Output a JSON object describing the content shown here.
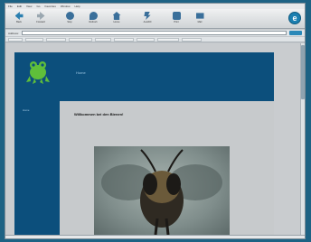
{
  "menubar": {
    "items": [
      "File",
      "Edit",
      "View",
      "Go",
      "Favorites",
      "Window",
      "Help"
    ]
  },
  "toolbar": {
    "buttons": [
      {
        "label": "Back",
        "icon": "back-arrow-icon",
        "color": "#2a7fb0"
      },
      {
        "label": "Forward",
        "icon": "forward-arrow-icon",
        "color": "#9aa7b0"
      },
      {
        "label": "Stop",
        "icon": "stop-icon",
        "color": "#3a6f9a"
      },
      {
        "label": "Refresh",
        "icon": "refresh-icon",
        "color": "#3a6f9a"
      },
      {
        "label": "Home",
        "icon": "home-icon",
        "color": "#3a6f9a"
      },
      {
        "label": "AutoFill",
        "icon": "autofill-icon",
        "color": "#3a6f9a"
      },
      {
        "label": "Print",
        "icon": "print-icon",
        "color": "#3a6f9a"
      },
      {
        "label": "Mail",
        "icon": "mail-icon",
        "color": "#3a6f9a"
      }
    ],
    "brand_icon": "e"
  },
  "address": {
    "label": "Address:",
    "value": ""
  },
  "favorites": {
    "items": [
      "",
      "",
      "",
      "",
      "",
      "",
      "",
      "",
      ""
    ]
  },
  "page": {
    "header_title": "Home",
    "header_subtitle": "",
    "nav_items": [
      "Home",
      "",
      "",
      "",
      "",
      "",
      "",
      "",
      "",
      "",
      "",
      ""
    ],
    "current_nav_index": 9,
    "welcome": "Willkommen bei den Bienen!",
    "paragraphs": [
      "",
      ""
    ]
  },
  "status": {
    "text": ""
  },
  "colors": {
    "header_bg": "#0c4f7c",
    "sidebar_bg": "#0c4f7c",
    "content_bg": "#c7cacc",
    "nav_text": "#a8cce6",
    "link_text": "#1e3a8a"
  }
}
